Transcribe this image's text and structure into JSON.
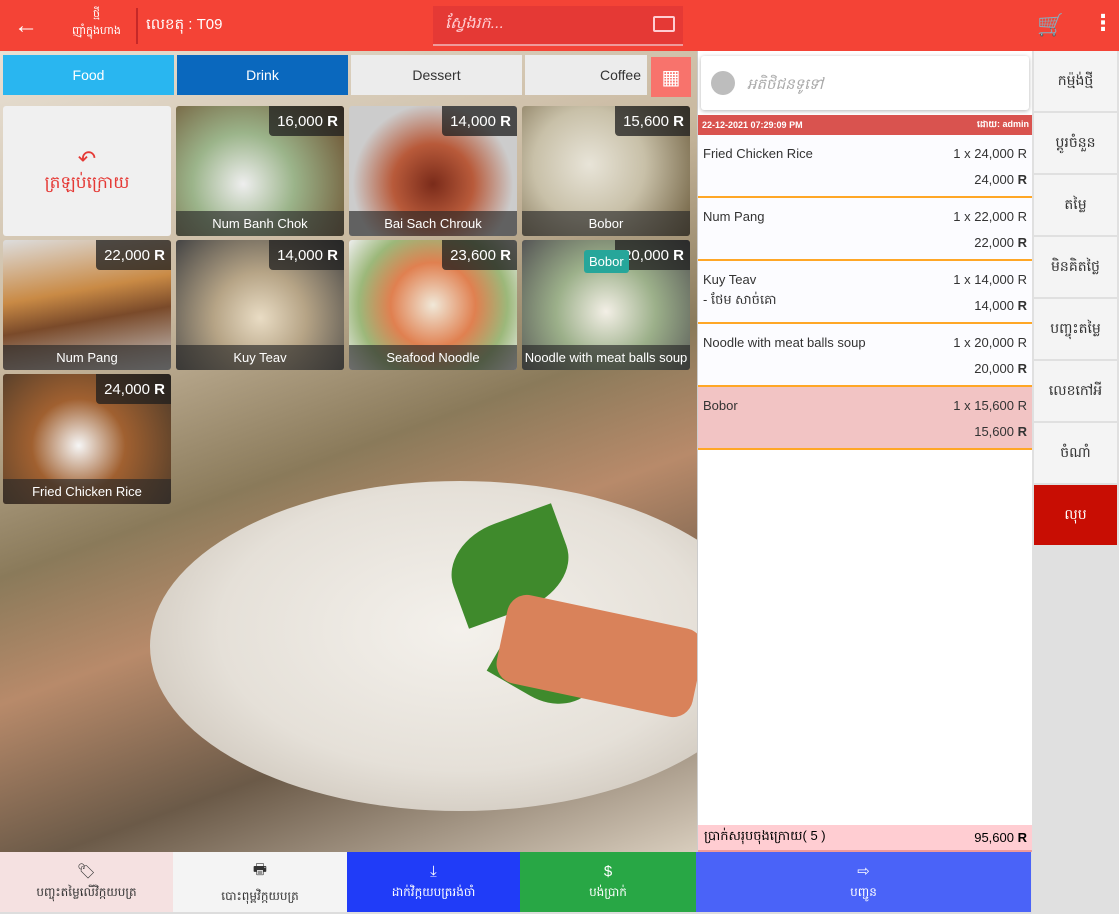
{
  "header": {
    "mode_top": "ថ្មី",
    "mode_bottom": "ញ៉ាំក្នុងហាង",
    "table_no": "លេខតុ : T09",
    "search_placeholder": "ស្វែងរក..."
  },
  "categories": [
    {
      "label": "Food",
      "color": "#29b6f0",
      "text": "#fff"
    },
    {
      "label": "Drink",
      "color": "#0a68be",
      "text": "#fff"
    },
    {
      "label": "Dessert",
      "color": "#ececec",
      "text": "#333"
    },
    {
      "label": "Coffee",
      "color": "#ececec",
      "text": "#333"
    }
  ],
  "back_tile_label": "ត្រឡប់ក្រោយ",
  "products": [
    {
      "name": "Num Banh Chok",
      "price": "16,000",
      "currency": "R"
    },
    {
      "name": "Bai Sach Chrouk",
      "price": "14,000",
      "currency": "R"
    },
    {
      "name": "Bobor",
      "price": "15,600",
      "currency": "R"
    },
    {
      "name": "Num Pang",
      "price": "22,000",
      "currency": "R"
    },
    {
      "name": "Kuy Teav",
      "price": "14,000",
      "currency": "R"
    },
    {
      "name": "Seafood Noodle",
      "price": "23,600",
      "currency": "R"
    },
    {
      "name": "Noodle with meat balls soup",
      "price": "20,000",
      "currency": "R",
      "badge": "Bobor"
    },
    {
      "name": "Fried Chicken Rice",
      "price": "24,000",
      "currency": "R"
    }
  ],
  "order": {
    "customer_placeholder": "អតិថិជនទូទៅ",
    "datetime": "22-12-2021 07:29:09 PM",
    "by": "ដោយ: admin",
    "items": [
      {
        "name": "Fried Chicken Rice",
        "qty": "1 x 24,000 R",
        "total": "24,000",
        "currency": "R"
      },
      {
        "name": "Num Pang",
        "qty": "1 x 22,000 R",
        "total": "22,000",
        "currency": "R"
      },
      {
        "name": "Kuy Teav",
        "qty": "1 x 14,000 R",
        "total": "14,000",
        "currency": "R",
        "modifier": "- ថែម សាច់គោ"
      },
      {
        "name": "Noodle with meat balls soup",
        "qty": "1 x 20,000 R",
        "total": "20,000",
        "currency": "R"
      },
      {
        "name": "Bobor",
        "qty": "1 x 15,600 R",
        "total": "15,600",
        "currency": "R",
        "selected": true
      }
    ],
    "total_label": "ប្រាក់សរុបចុងក្រោយ( 5 )",
    "total_value": "95,600",
    "total_currency": "R"
  },
  "side_actions": [
    "កម្ម៉ង់ថ្មី",
    "ប្តូរចំនួន",
    "តម្លៃ",
    "មិនគិតថ្លៃ",
    "បញ្ចុះតម្លៃ",
    "លេខកៅអី",
    "ចំណាំ",
    "លុប"
  ],
  "bottom_actions": [
    {
      "label": "បញ្ចុះតម្លៃលើវិក្កយបត្រ",
      "icon": "tag-icon",
      "color": "#f5e1e1",
      "text": "#333",
      "glyph": "🏷"
    },
    {
      "label": "បោះពុម្ពវិក្កយបត្រ",
      "icon": "printer-icon",
      "color": "#f4f4f4",
      "text": "#333",
      "glyph": "🖶"
    },
    {
      "label": "ដាក់វិក្កយបត្ររង់ចាំ",
      "icon": "download-icon",
      "color": "#203cf8",
      "text": "#fff",
      "glyph": "⤓"
    },
    {
      "label": "បង់ប្រាក់",
      "icon": "dollar-icon",
      "color": "#28a745",
      "text": "#fff",
      "glyph": "$"
    },
    {
      "label": "បញ្ជូន",
      "icon": "arrow-right-icon",
      "color": "#4a63f8",
      "text": "#fff",
      "glyph": "⇨"
    }
  ]
}
